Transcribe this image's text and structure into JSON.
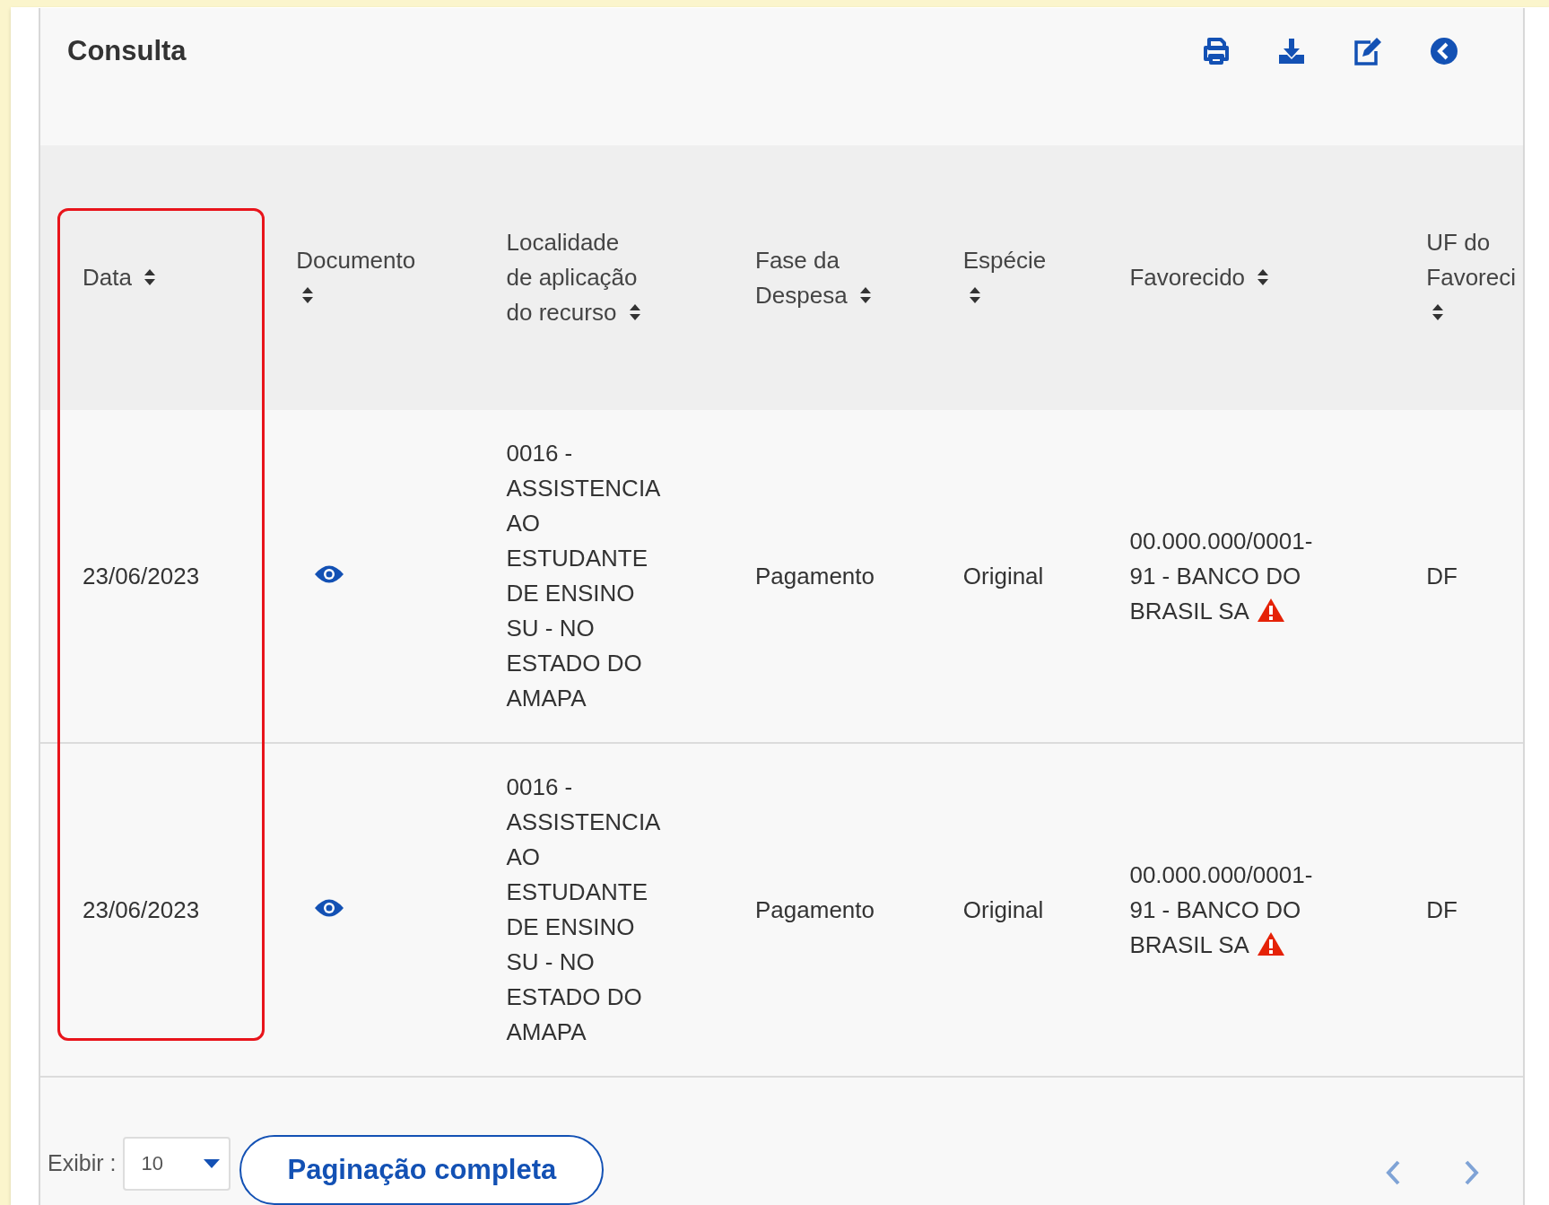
{
  "panel": {
    "title": "Consulta"
  },
  "toolbar": [
    {
      "kind": "print"
    },
    {
      "kind": "download"
    },
    {
      "kind": "edit"
    },
    {
      "kind": "back"
    }
  ],
  "table": {
    "columns": [
      {
        "label": "Data",
        "highlighted": true
      },
      {
        "label": "Documento",
        "highlighted": false
      },
      {
        "label": "Localidade de aplicação do recurso",
        "highlighted": false
      },
      {
        "label": "Fase da Despesa",
        "highlighted": false
      },
      {
        "label": "Espécie",
        "highlighted": false
      },
      {
        "label": "Favorecido",
        "highlighted": false
      },
      {
        "label": "UF do Favoreci",
        "highlighted": false
      }
    ],
    "rows": [
      {
        "data": "23/06/2023",
        "documento": {
          "kind": "view"
        },
        "localidade": "0016 - ASSISTENCIA AO ESTUDANTE DE ENSINO SU - NO ESTADO DO AMAPA",
        "fase": "Pagamento",
        "especie": "Original",
        "favorecido": {
          "text": "00.000.000/0001-91 - BANCO DO BRASIL SA",
          "warning": true
        },
        "uf": "DF"
      },
      {
        "data": "23/06/2023",
        "documento": {
          "kind": "view"
        },
        "localidade": "0016 - ASSISTENCIA AO ESTUDANTE DE ENSINO SU - NO ESTADO DO AMAPA",
        "fase": "Pagamento",
        "especie": "Original",
        "favorecido": {
          "text": "00.000.000/0001-91 - BANCO DO BRASIL SA",
          "warning": true
        },
        "uf": "DF"
      }
    ]
  },
  "footer": {
    "show_label": "Exibir :",
    "page_size": "10",
    "full_pagination_button": "Paginação completa"
  }
}
